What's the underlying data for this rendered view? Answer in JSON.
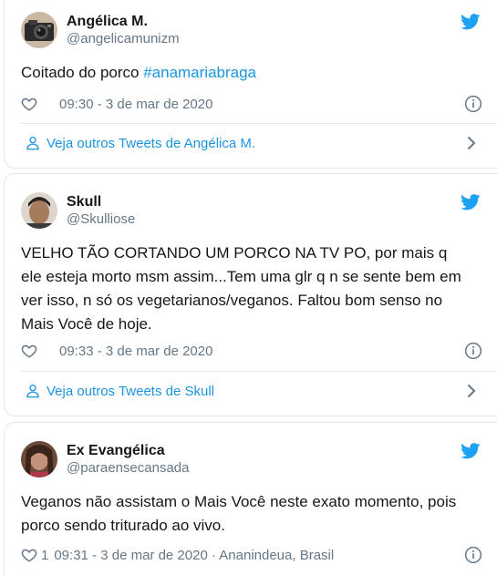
{
  "tweets": [
    {
      "display_name": "Angélica M.",
      "handle": "@angelicamunizm",
      "text_prefix": "Coitado do porco ",
      "hashtag": "#anamariabraga",
      "like_count": "",
      "meta": "09:30 - 3 de mar de 2020",
      "more_label": "Veja outros Tweets de Angélica M.",
      "avatar_icon": "camera-avatar"
    },
    {
      "display_name": "Skull",
      "handle": "@Skulliose",
      "text_lines": [
        "VELHO TÃO CORTANDO UM PORCO NA TV PO, por mais q",
        "ele esteja morto msm assim...Tem uma glr q n se sente bem em",
        "ver isso, n só os vegetarianos/veganos. Faltou bom senso no",
        "Mais Você de hoje."
      ],
      "like_count": "",
      "meta": "09:33 - 3 de mar de 2020",
      "more_label": "Veja outros Tweets de Skull",
      "avatar_icon": "person-photo-avatar"
    },
    {
      "display_name": "Ex Evangélica",
      "handle": "@paraensecansada",
      "text_lines": [
        "Veganos não assistam o Mais Você neste exato momento, pois",
        "porco sendo triturado ao vivo."
      ],
      "like_count": "1",
      "meta": "09:31 - 3 de mar de 2020 · Ananindeua, Brasil",
      "avatar_icon": "person-photo-avatar"
    }
  ],
  "colors": {
    "twitter_blue": "#1da1f2",
    "link_blue": "#1b95e0",
    "text": "#14171a",
    "secondary": "#657786",
    "border": "#e1e8ed"
  }
}
